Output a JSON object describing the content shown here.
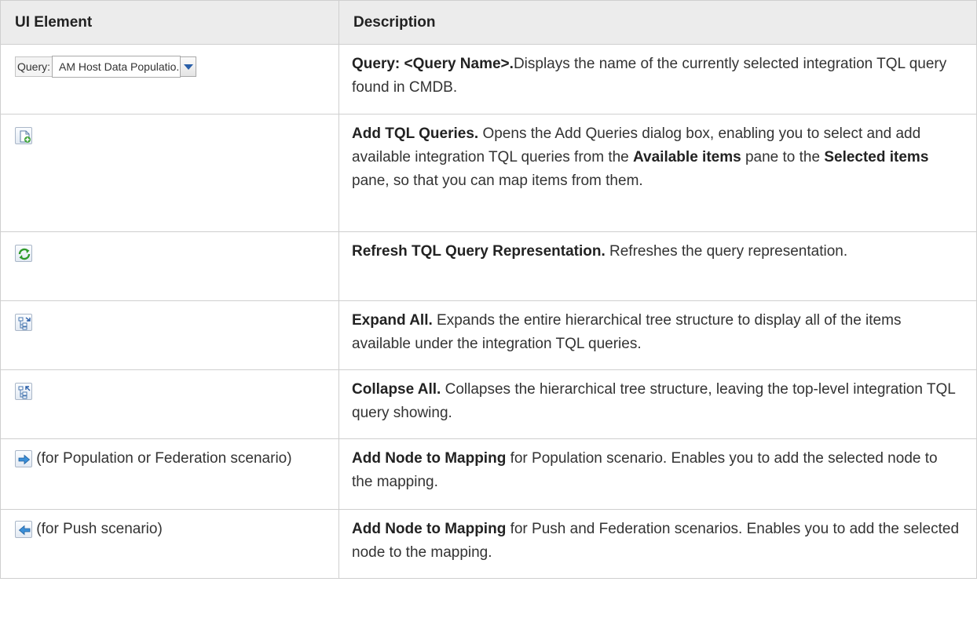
{
  "header": {
    "col1": "UI Element",
    "col2": "Description"
  },
  "query_control": {
    "label": "Query:",
    "value": "AM Host Data Populatio..."
  },
  "rows": [
    {
      "icon": "query-dropdown",
      "desc_bold": "Query: <Query Name>.",
      "desc_text": "Displays the name of the currently selected integration TQL query found in CMDB."
    },
    {
      "icon": "add-queries-icon",
      "desc_bold": "Add TQL Queries.",
      "desc_text1": " Opens the Add Queries dialog box, enabling you to select and add available integration TQL queries from the ",
      "desc_bold2": "Available items",
      "desc_text2": " pane to the ",
      "desc_bold3": "Selected items",
      "desc_text3": " pane, so that you can map items from them."
    },
    {
      "icon": "refresh-icon",
      "desc_bold": "Refresh TQL Query Representation.",
      "desc_text": " Refreshes the query representation."
    },
    {
      "icon": "expand-all-icon",
      "desc_bold": "Expand All.",
      "desc_text": " Expands the entire hierarchical tree structure to display all of the items available under the integration TQL queries."
    },
    {
      "icon": "collapse-all-icon",
      "desc_bold": "Collapse All.",
      "desc_text": " Collapses the hierarchical tree structure, leaving the top-level integration TQL query showing."
    },
    {
      "icon": "arrow-right-icon",
      "elem_text": " (for Population or Federation scenario)",
      "desc_bold": "Add Node to Mapping",
      "desc_text": " for Population scenario. Enables you to add the selected node to the mapping."
    },
    {
      "icon": "arrow-left-icon",
      "elem_text": " (for Push scenario)",
      "desc_bold": "Add Node to Mapping",
      "desc_text": " for Push and Federation scenarios. Enables you to add the selected node to the mapping."
    }
  ]
}
